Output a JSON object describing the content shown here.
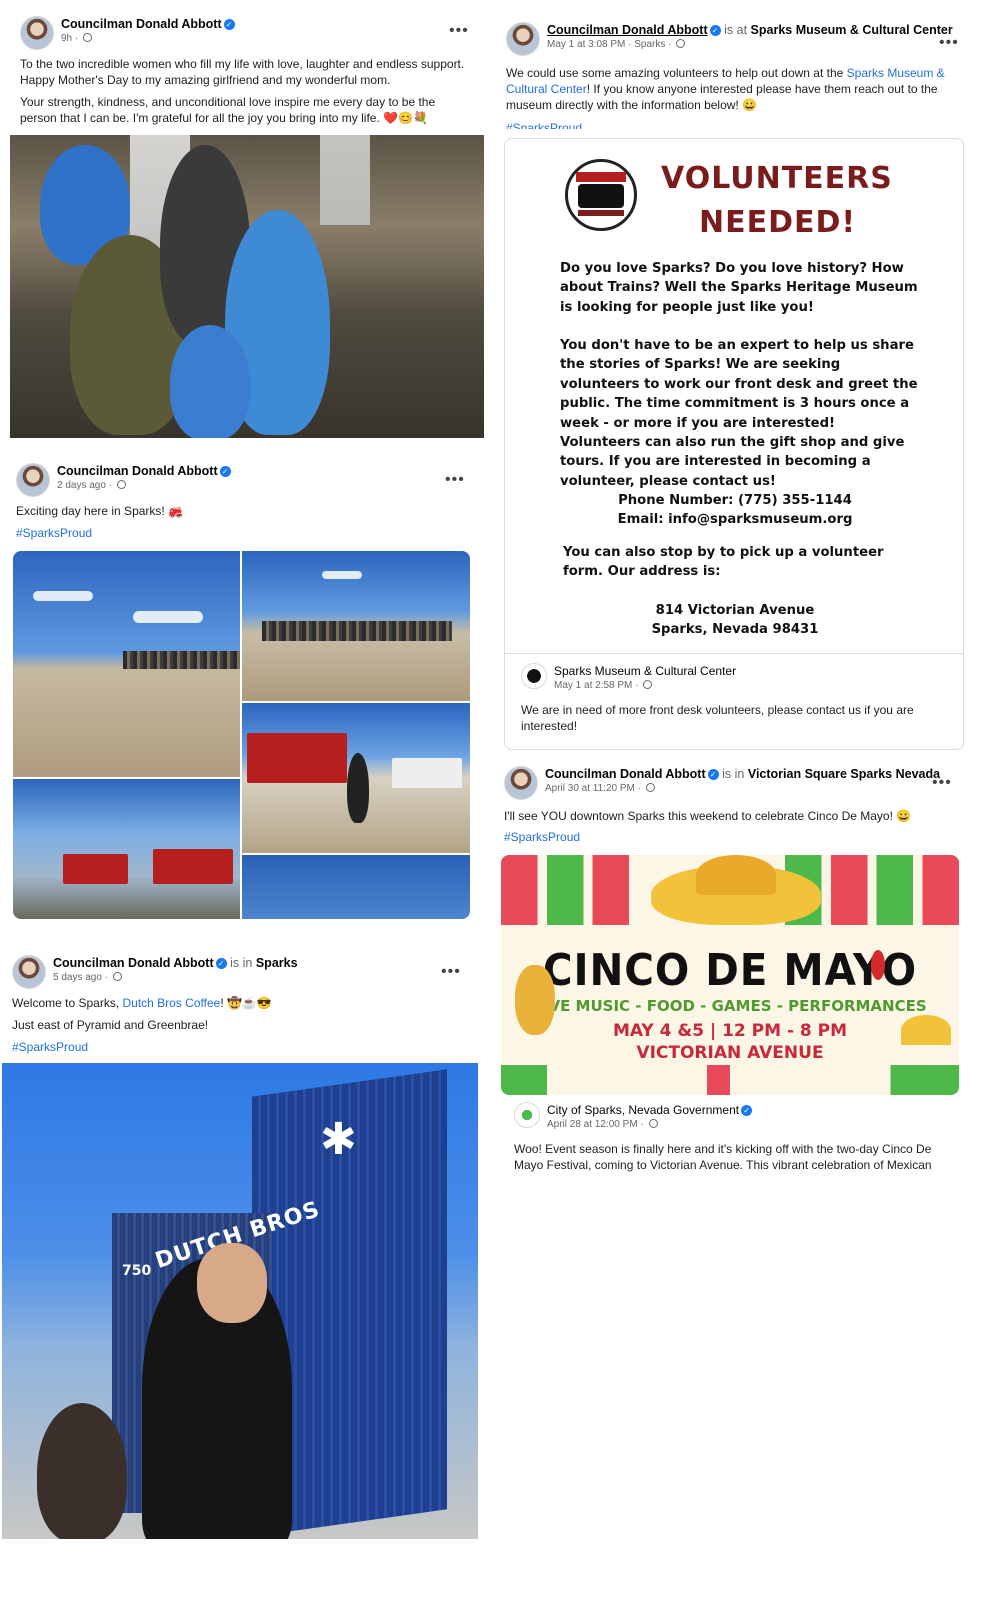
{
  "posts": {
    "mothers_day": {
      "author": "Councilman Donald Abbott",
      "time": "9h",
      "line1": "To the two incredible women who fill my life with love, laughter and endless support. Happy Mother's Day to my amazing girlfriend and my wonderful mom.",
      "line2": "Your strength, kindness, and unconditional love inspire me every day to be the person that I can be. I'm grateful for all the joy you bring into my life. ❤️😊💐"
    },
    "groundbreaking": {
      "author": "Councilman Donald Abbott",
      "time": "2 days ago",
      "text": "Exciting day here in Sparks! 🚒",
      "hashtag": "#SparksProud"
    },
    "dutch_bros": {
      "author": "Councilman Donald Abbott",
      "is_in": "is in",
      "place": "Sparks",
      "time": "5 days ago",
      "text_pre": "Welcome to Sparks, ",
      "text_link": "Dutch Bros Coffee",
      "text_post": "! 🤠☕😎",
      "line2": "Just east of Pyramid and Greenbrae!",
      "hashtag": "#SparksProud"
    },
    "museum": {
      "author": "Councilman Donald Abbott",
      "is_at": "is at",
      "place": "Sparks Museum & Cultural Center",
      "time": "May 1 at 3:08 PM · Sparks",
      "text_pre": "We could use some amazing volunteers to help out down at the ",
      "text_link": "Sparks Museum & Cultural Center",
      "text_post": "! If you know anyone interested please have them reach out to the museum directly with the information below! 😀",
      "hashtag": "#SparksProud",
      "poster": {
        "title1": "VOLUNTEERS",
        "title2": "NEEDED!",
        "p1": "Do you love Sparks? Do you love history? How about Trains? Well the Sparks Heritage Museum is looking for people just like you!",
        "p2": "You don't have to be an expert to help us share the stories of Sparks! We are seeking volunteers to work our front desk and greet the public. The time commitment is 3 hours once a week - or more if you are interested! Volunteers can also run the gift shop and give tours. If you are interested in becoming a volunteer, please contact us!",
        "phone": "Phone Number: (775) 355-1144",
        "email": "Email: info@sparksmuseum.org",
        "p3": "You can also stop by to pick up a volunteer form. Our address is:",
        "addr1": "814 Victorian Avenue",
        "addr2": "Sparks, Nevada 98431"
      },
      "shared": {
        "author": "Sparks Museum & Cultural Center",
        "time": "May 1 at 2:58 PM",
        "text": "We are in need of more front desk volunteers, please contact us if you are interested!"
      }
    },
    "cinco": {
      "author": "Councilman Donald Abbott",
      "is_in": "is in",
      "place": "Victorian Square Sparks Nevada",
      "time": "April 30 at 11:20 PM",
      "text": "I'll see YOU downtown Sparks this weekend to celebrate Cinco De Mayo! 😀",
      "hashtag": "#SparksProud",
      "poster": {
        "title": "CINCO DE MAYO",
        "line1": "LIVE MUSIC - FOOD - GAMES - PERFORMANCES",
        "line2": "MAY 4 &5 | 12 PM - 8 PM",
        "line3": "VICTORIAN AVENUE"
      },
      "shared": {
        "author": "City of Sparks, Nevada Government",
        "time": "April 28 at 12:00 PM",
        "text": "Woo! Event season is finally here and it's kicking off with the two-day Cinco De Mayo Festival, coming to Victorian Avenue. This vibrant celebration of Mexican"
      }
    },
    "dutch_sign": {
      "brand": "DUTCH BROS",
      "number": "750"
    }
  },
  "ui": {
    "more": "•••",
    "verified": "✓",
    "sep": " · "
  },
  "colors": {
    "link": "#216fdb",
    "verified": "#1877f2",
    "poster_red": "#7b1c1c"
  }
}
